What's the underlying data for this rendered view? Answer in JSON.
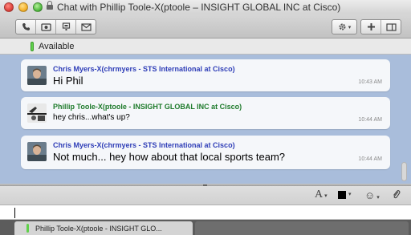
{
  "window": {
    "title": "Chat with Phillip Toole-X(ptoole – INSIGHT GLOBAL INC at Cisco)"
  },
  "toolbar": {
    "left_buttons": [
      "phone-icon",
      "video-icon",
      "screen-share-icon",
      "email-icon"
    ],
    "right_buttons": [
      "gear-icon",
      "add-participant-icon",
      "panel-toggle-icon"
    ]
  },
  "status": {
    "label": "Available",
    "color": "#5fd14a"
  },
  "messages": [
    {
      "sender": "Chris Myers-X(chrmyers - STS International at Cisco)",
      "text": "Hi Phil",
      "time": "10:43 AM",
      "sender_color": "#2e3db7"
    },
    {
      "sender": "Phillip Toole-X(ptoole - INSIGHT GLOBAL INC at Cisco)",
      "text": "hey chris...what's up?",
      "time": "10:44 AM",
      "sender_color": "#1f7b2c"
    },
    {
      "sender": "Chris Myers-X(chrmyers - STS International at Cisco)",
      "text": "Not much... hey how about that local sports team?",
      "time": "10:44 AM",
      "sender_color": "#2e3db7"
    }
  ],
  "compose_toolbar": {
    "font_glyph": "A",
    "dropdown_glyph": "▾",
    "emoji_glyph": "☺",
    "attach_glyph": "⌀"
  },
  "tabs": [
    {
      "label": "Phillip Toole-X(ptoole - INSIGHT GLO...",
      "active": true
    }
  ]
}
